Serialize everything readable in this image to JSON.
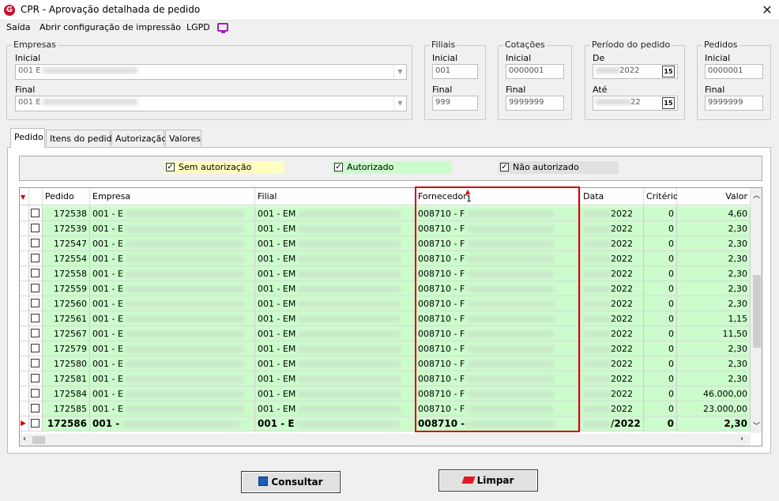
{
  "window": {
    "title": "CPR - Aprovação detalhada de pedido",
    "app_icon": "G",
    "close": "✕"
  },
  "menu": {
    "exit": "Saída",
    "print_config": "Abrir configuração de impressão",
    "lgpd": "LGPD"
  },
  "filters": {
    "empresas": {
      "legend": "Empresas",
      "inicial_label": "Inicial",
      "inicial_value": "001 E",
      "final_label": "Final",
      "final_value": "001 E"
    },
    "filiais": {
      "legend": "Filiais",
      "inicial_label": "Inicial",
      "inicial_value": "001",
      "final_label": "Final",
      "final_value": "999"
    },
    "cotacoes": {
      "legend": "Cotações",
      "inicial_label": "Inicial",
      "inicial_value": "0000001",
      "final_label": "Final",
      "final_value": "9999999"
    },
    "periodo": {
      "legend": "Período do pedido",
      "de_label": "De",
      "de_value": "2022",
      "ate_label": "Até",
      "ate_value": "22",
      "cal": "15"
    },
    "pedidos": {
      "legend": "Pedidos",
      "inicial_label": "Inicial",
      "inicial_value": "0000001",
      "final_label": "Final",
      "final_value": "9999999"
    }
  },
  "tabs": [
    {
      "label": "Pedido"
    },
    {
      "label": "Itens do pedido"
    },
    {
      "label": "Autorização"
    },
    {
      "label": "Valores"
    }
  ],
  "legend": {
    "sem": "Sem autorização",
    "autorizado": "Autorizado",
    "nao": "Não autorizado",
    "colors": {
      "sem": "#ffffc0",
      "autorizado": "#ccfccc",
      "nao": "#e0e0e0"
    }
  },
  "grid": {
    "headers": {
      "pedido": "Pedido",
      "empresa": "Empresa",
      "filial": "Filial",
      "fornecedor": "Fornecedor",
      "sort_index": "1",
      "data": "Data",
      "criterio": "Critério",
      "valor": "Valor"
    },
    "rows": [
      {
        "pedido": "172538",
        "empresa": "001 - E",
        "filial": "001 - EM",
        "fornecedor": "008710 - F",
        "data": "2022",
        "criterio": "0",
        "valor": "4,60"
      },
      {
        "pedido": "172539",
        "empresa": "001 - E",
        "filial": "001 - EM",
        "fornecedor": "008710 - F",
        "data": "2022",
        "criterio": "0",
        "valor": "2,30"
      },
      {
        "pedido": "172547",
        "empresa": "001 - E",
        "filial": "001 - EM",
        "fornecedor": "008710 - F",
        "data": "2022",
        "criterio": "0",
        "valor": "2,30"
      },
      {
        "pedido": "172554",
        "empresa": "001 - E",
        "filial": "001 - EM",
        "fornecedor": "008710 - F",
        "data": "2022",
        "criterio": "0",
        "valor": "2,30"
      },
      {
        "pedido": "172558",
        "empresa": "001 - E",
        "filial": "001 - EM",
        "fornecedor": "008710 - F",
        "data": "2022",
        "criterio": "0",
        "valor": "2,30"
      },
      {
        "pedido": "172559",
        "empresa": "001 - E",
        "filial": "001 - EM",
        "fornecedor": "008710 - F",
        "data": "2022",
        "criterio": "0",
        "valor": "2,30"
      },
      {
        "pedido": "172560",
        "empresa": "001 - E",
        "filial": "001 - EM",
        "fornecedor": "008710 - F",
        "data": "2022",
        "criterio": "0",
        "valor": "2,30"
      },
      {
        "pedido": "172561",
        "empresa": "001 - E",
        "filial": "001 - EM",
        "fornecedor": "008710 - F",
        "data": "2022",
        "criterio": "0",
        "valor": "1,15"
      },
      {
        "pedido": "172567",
        "empresa": "001 - E",
        "filial": "001 - EM",
        "fornecedor": "008710 - F",
        "data": "2022",
        "criterio": "0",
        "valor": "11,50"
      },
      {
        "pedido": "172579",
        "empresa": "001 - E",
        "filial": "001 - EM",
        "fornecedor": "008710 - F",
        "data": "2022",
        "criterio": "0",
        "valor": "2,30"
      },
      {
        "pedido": "172580",
        "empresa": "001 - E",
        "filial": "001 - EM",
        "fornecedor": "008710 - F",
        "data": "2022",
        "criterio": "0",
        "valor": "2,30"
      },
      {
        "pedido": "172581",
        "empresa": "001 - E",
        "filial": "001 - EM",
        "fornecedor": "008710 - F",
        "data": "2022",
        "criterio": "0",
        "valor": "2,30"
      },
      {
        "pedido": "172584",
        "empresa": "001 - E",
        "filial": "001 - EM",
        "fornecedor": "008710 - F",
        "data": "2022",
        "criterio": "0",
        "valor": "46.000,00"
      },
      {
        "pedido": "172585",
        "empresa": "001 - E",
        "filial": "001 - EM",
        "fornecedor": "008710 - F",
        "data": "2022",
        "criterio": "0",
        "valor": "23.000,00"
      },
      {
        "pedido": "172586",
        "empresa": "001 -",
        "filial": "001 - E",
        "fornecedor": "008710 -",
        "data": "/2022",
        "criterio": "0",
        "valor": "2,30"
      }
    ]
  },
  "buttons": {
    "consultar": "Consultar",
    "limpar": "Limpar"
  }
}
